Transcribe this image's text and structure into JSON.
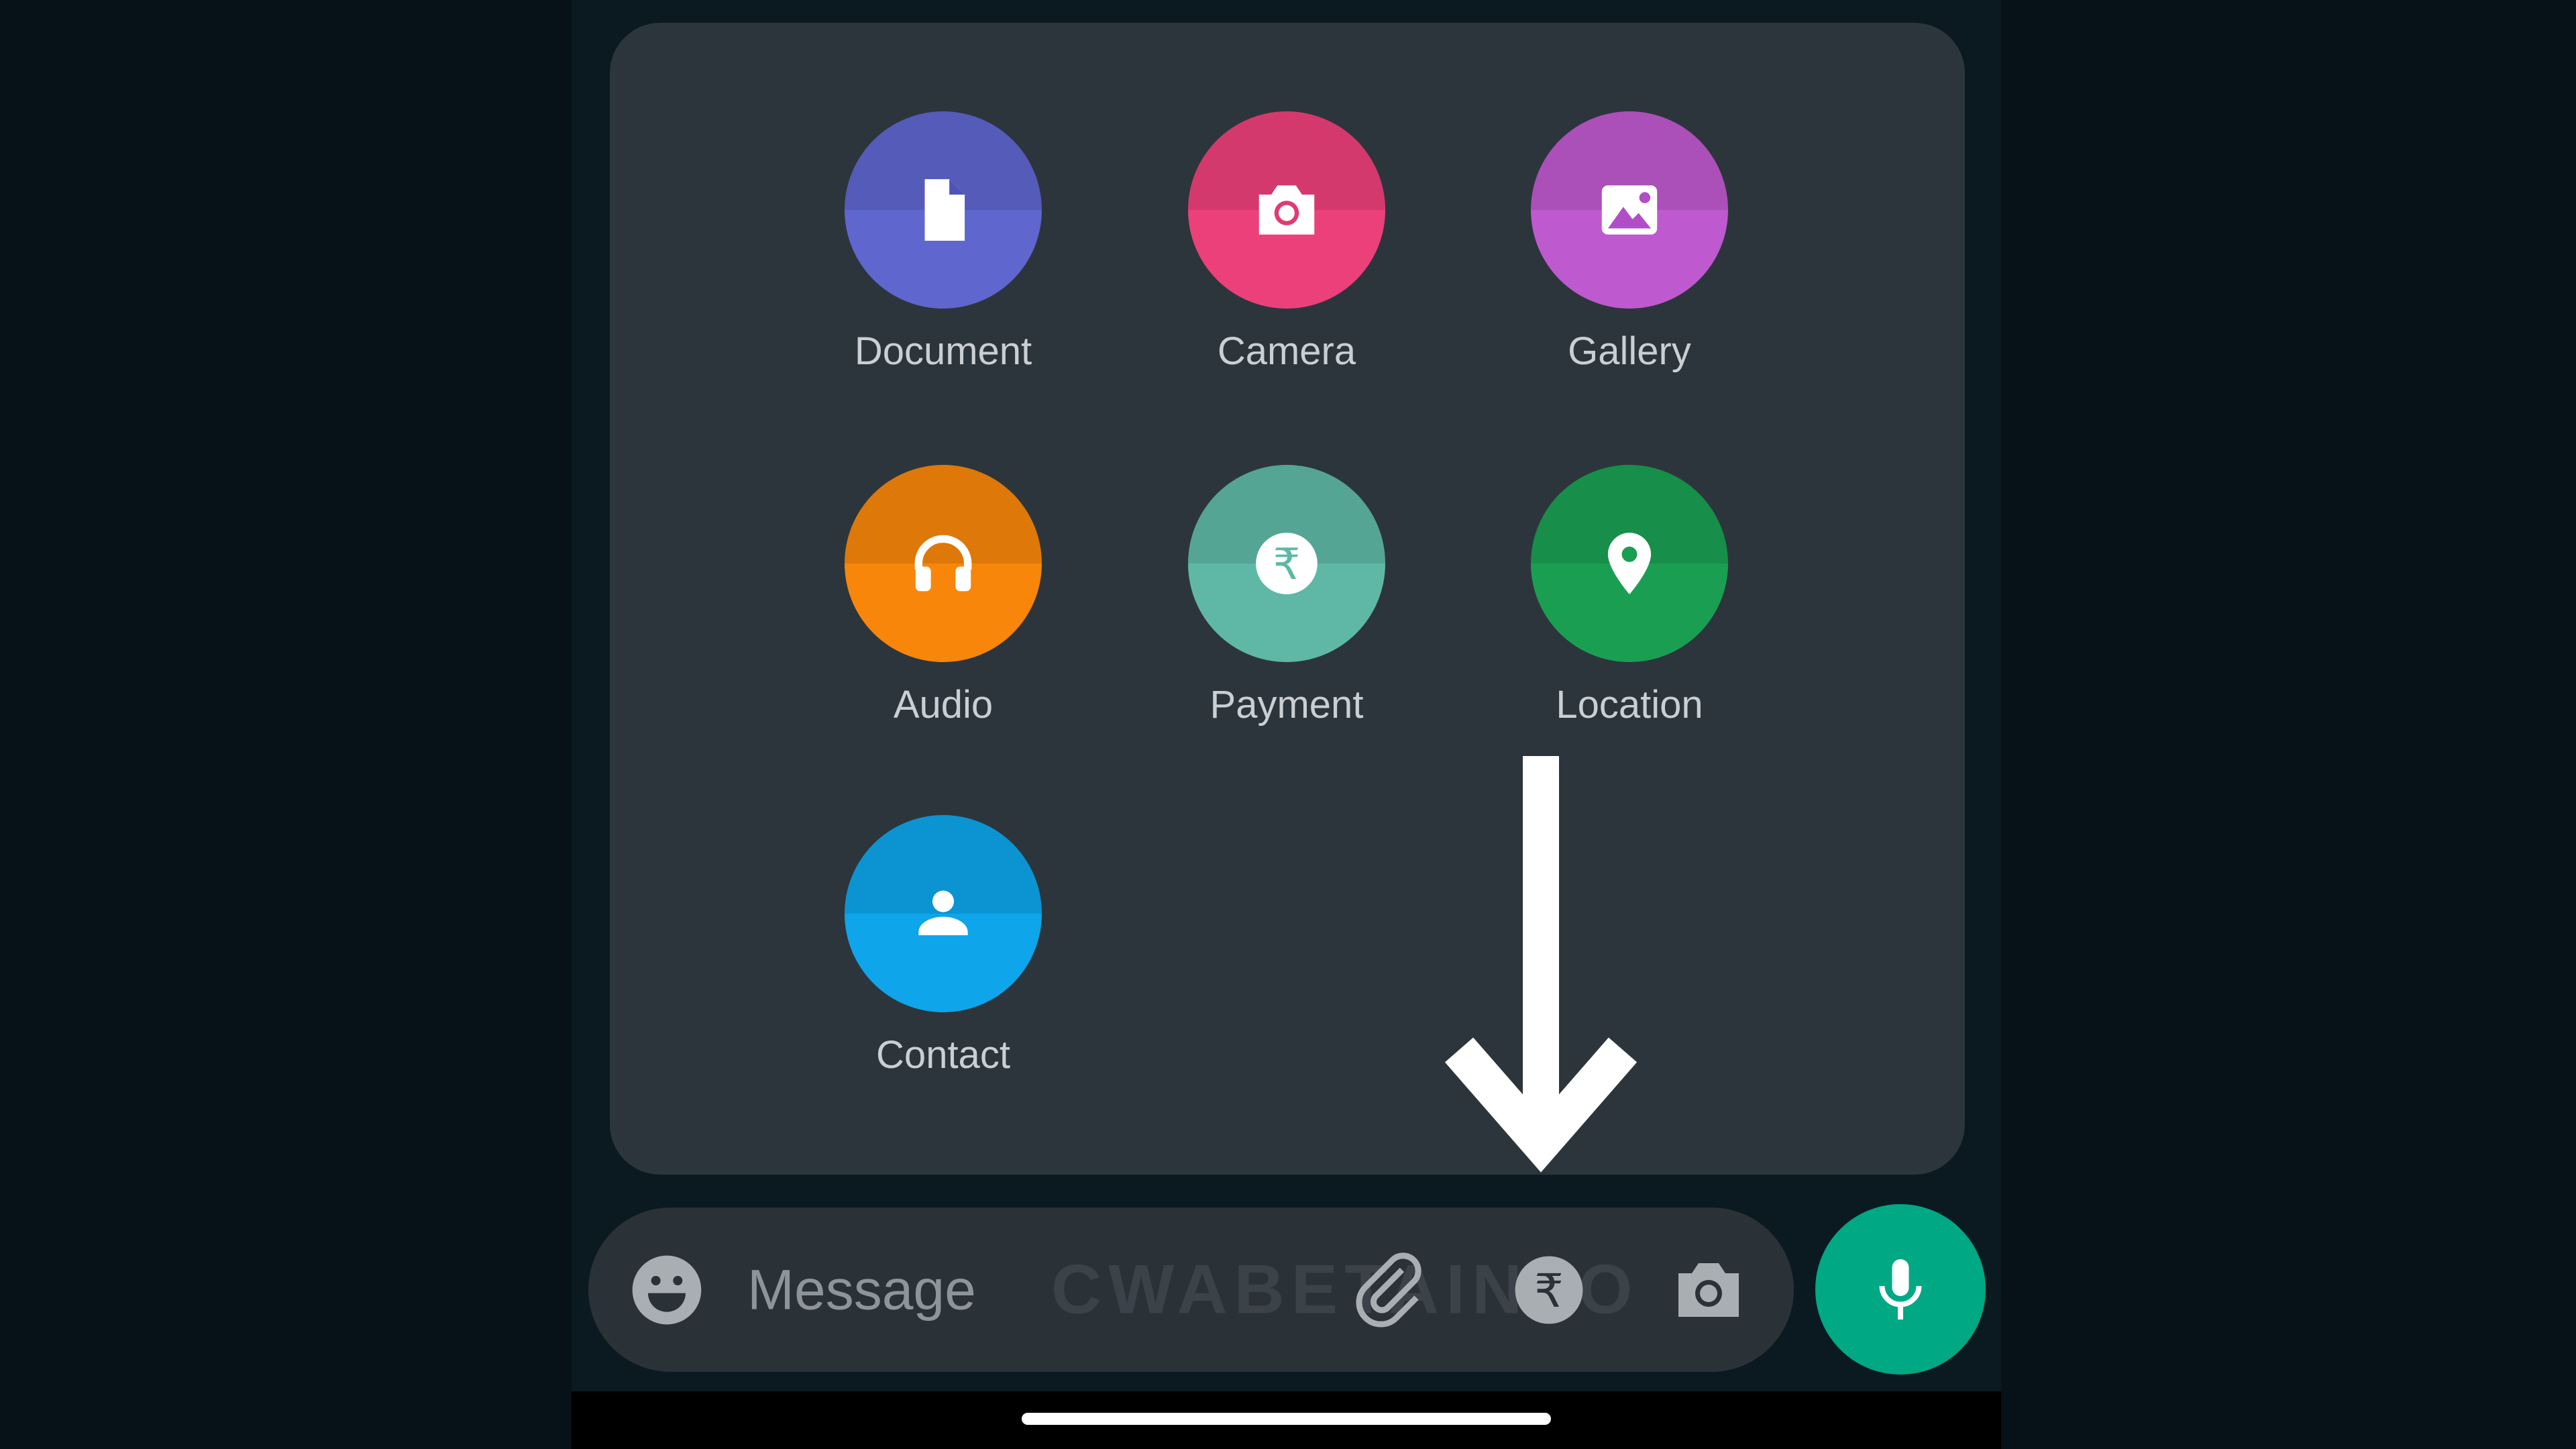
{
  "attach_menu": {
    "items": [
      {
        "label": "Document",
        "icon": "document-icon",
        "color": "#5f66cd"
      },
      {
        "label": "Camera",
        "icon": "camera-icon",
        "color": "#ec407a"
      },
      {
        "label": "Gallery",
        "icon": "gallery-icon",
        "color": "#bf59cf"
      },
      {
        "label": "Audio",
        "icon": "headphones-icon",
        "color": "#f7860b"
      },
      {
        "label": "Payment",
        "icon": "rupee-icon",
        "color": "#5fb8a5"
      },
      {
        "label": "Location",
        "icon": "location-pin-icon",
        "color": "#1a9f52"
      },
      {
        "label": "Contact",
        "icon": "contact-icon",
        "color": "#0ea5ea"
      }
    ]
  },
  "composer": {
    "placeholder": "Message",
    "watermark": "CWABETAINFO",
    "accent": "#00a884"
  }
}
